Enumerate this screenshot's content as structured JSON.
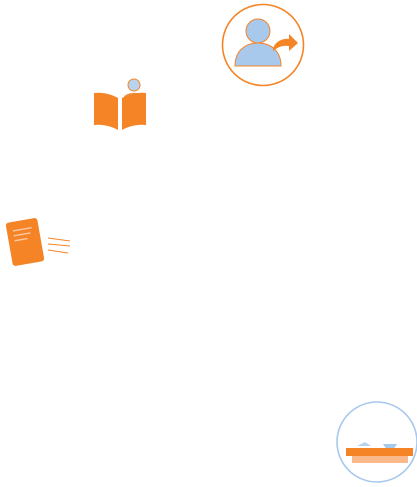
{
  "icons": [
    "user-share-icon",
    "reading-person-icon",
    "document-sending-icon",
    "tray-icon"
  ],
  "colors": {
    "orange": "#f58426",
    "light_orange": "#f9b98a",
    "blue": "#a8c8ec",
    "light_blue": "#b9d3ef",
    "background": "#ffffff"
  }
}
